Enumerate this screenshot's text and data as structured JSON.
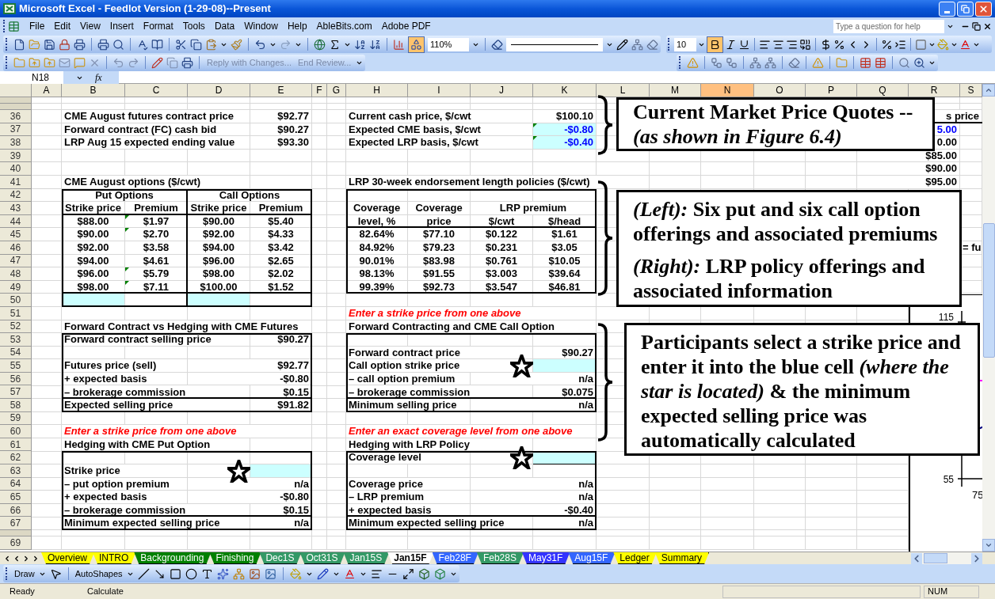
{
  "window": {
    "title": "Microsoft Excel - Feedlot Version (1-29-08)--Present"
  },
  "menu": [
    "File",
    "Edit",
    "View",
    "Insert",
    "Format",
    "Tools",
    "Data",
    "Window",
    "Help",
    "AbleBits.com",
    "Adobe PDF"
  ],
  "help_field": {
    "placeholder": "Type a question for help"
  },
  "standard_toolbar": {
    "zoom": "110%",
    "drawing_pressed": true
  },
  "formatting_toolbar": {
    "font_size": "10",
    "bold_pressed": true
  },
  "reviewing_toolbar": {
    "reply": "Reply with Changes...",
    "end_review": "End Review..."
  },
  "formula_bar": {
    "name_box": "N18",
    "fx_label": "fx"
  },
  "sheet": {
    "columns": [
      {
        "label": "A",
        "selected": false
      },
      {
        "label": "B",
        "selected": false
      },
      {
        "label": "C",
        "selected": false
      },
      {
        "label": "D",
        "selected": false
      },
      {
        "label": "E",
        "selected": false
      },
      {
        "label": "F",
        "selected": false
      },
      {
        "label": "G",
        "selected": false
      },
      {
        "label": "H",
        "selected": false
      },
      {
        "label": "I",
        "selected": false
      },
      {
        "label": "J",
        "selected": false
      },
      {
        "label": "K",
        "selected": false
      },
      {
        "label": "L",
        "selected": false
      },
      {
        "label": "M",
        "selected": false
      },
      {
        "label": "N",
        "selected": true
      },
      {
        "label": "O",
        "selected": false
      },
      {
        "label": "P",
        "selected": false
      },
      {
        "label": "Q",
        "selected": false
      },
      {
        "label": "R",
        "selected": false
      },
      {
        "label": "S",
        "selected": false
      }
    ],
    "rows": [
      {
        "collapsed": true,
        "cells": []
      },
      {
        "collapsed": true,
        "cells": []
      },
      {
        "collapsed": false,
        "number": "36",
        "cells": [
          "",
          {
            "text": "CME August futures contract price",
            "kind": "label"
          },
          "",
          "",
          {
            "text": "$92.77",
            "kind": "value"
          },
          "",
          "",
          {
            "text": "Current cash price, $/cwt",
            "kind": "label"
          },
          "",
          "",
          {
            "text": "$100.10",
            "kind": "value"
          },
          "",
          "",
          "",
          "",
          "",
          "",
          "",
          {
            "text": "s price",
            "kind": "value"
          }
        ]
      },
      {
        "collapsed": false,
        "number": "37",
        "cells": [
          "",
          {
            "text": "Forward contract (FC) cash bid",
            "kind": "label"
          },
          "",
          "",
          {
            "text": "$90.27",
            "kind": "value"
          },
          "",
          "",
          {
            "text": "Expected CME basis, $/cwt",
            "kind": "label"
          },
          "",
          "",
          {
            "text": "-$0.80",
            "kind": "input",
            "flagged": true,
            "starred": false
          },
          "",
          "",
          "",
          "",
          "",
          "",
          {
            "text": "5.00",
            "kind": "blue"
          }
        ]
      },
      {
        "collapsed": false,
        "number": "38",
        "cells": [
          "",
          {
            "text": "LRP Aug 15 expected ending value",
            "kind": "label"
          },
          "",
          "",
          {
            "text": "$93.30",
            "kind": "value"
          },
          "",
          "",
          {
            "text": "Expected LRP basis, $/cwt",
            "kind": "label"
          },
          "",
          "",
          {
            "text": "-$0.40",
            "kind": "input",
            "flagged": true,
            "starred": false
          },
          "",
          "",
          "",
          "",
          "",
          "",
          {
            "text": "0.00",
            "kind": "value"
          }
        ]
      },
      {
        "collapsed": false,
        "number": "39",
        "cells": [
          "",
          "",
          "",
          "",
          "",
          "",
          "",
          "",
          "",
          "",
          "",
          "",
          "",
          "",
          "",
          "",
          "",
          {
            "text": "$85.00",
            "kind": "value"
          }
        ]
      },
      {
        "collapsed": false,
        "number": "40",
        "cells": [
          "",
          "",
          "",
          "",
          "",
          "",
          "",
          "",
          "",
          "",
          "",
          "",
          "",
          "",
          "",
          "",
          "",
          {
            "text": "$90.00",
            "kind": "value"
          }
        ]
      },
      {
        "collapsed": false,
        "number": "41",
        "cells": [
          "",
          {
            "text": "CME August options ($/cwt)",
            "kind": "label"
          },
          "",
          "",
          "",
          "",
          "",
          {
            "text": "LRP 30-week endorsement length policies ($/cwt)",
            "kind": "label"
          },
          "",
          "",
          "",
          "",
          "",
          "",
          "",
          "",
          "",
          {
            "text": "$95.00",
            "kind": "value"
          }
        ]
      },
      {
        "collapsed": false,
        "number": "42",
        "cells": [
          "",
          {
            "text": "Put Options",
            "kind": "center"
          },
          "",
          {
            "text": "Call Options",
            "kind": "center"
          },
          ""
        ]
      },
      {
        "collapsed": false,
        "number": "43",
        "cells": [
          "",
          {
            "text": "Strike price",
            "kind": "center"
          },
          {
            "text": "Premium",
            "kind": "center"
          },
          {
            "text": "Strike price",
            "kind": "center"
          },
          {
            "text": "Premium",
            "kind": "center"
          },
          "",
          "",
          {
            "text": "Coverage",
            "kind": "center"
          },
          {
            "text": "Coverage",
            "kind": "center"
          },
          {
            "text": "LRP premium",
            "kind": "center"
          },
          ""
        ]
      },
      {
        "collapsed": false,
        "number": "44",
        "cells": [
          "",
          {
            "text": "$88.00",
            "kind": "center"
          },
          {
            "text": "$1.97",
            "kind": "center",
            "flagged": true
          },
          {
            "text": "$90.00",
            "kind": "center"
          },
          {
            "text": "$5.40",
            "kind": "center"
          },
          "",
          "",
          {
            "text": "level, %",
            "kind": "center"
          },
          {
            "text": "price",
            "kind": "center"
          },
          {
            "text": "$/cwt",
            "kind": "center"
          },
          {
            "text": "$/head",
            "kind": "center"
          }
        ]
      },
      {
        "collapsed": false,
        "number": "45",
        "cells": [
          "",
          {
            "text": "$90.00",
            "kind": "center"
          },
          {
            "text": "$2.70",
            "kind": "center",
            "flagged": true
          },
          {
            "text": "$92.00",
            "kind": "center"
          },
          {
            "text": "$4.33",
            "kind": "center"
          },
          "",
          "",
          {
            "text": "82.64%",
            "kind": "center"
          },
          {
            "text": "$77.10",
            "kind": "center"
          },
          {
            "text": "$0.122",
            "kind": "center"
          },
          {
            "text": "$1.61",
            "kind": "center"
          }
        ]
      },
      {
        "collapsed": false,
        "number": "46",
        "cells": [
          "",
          {
            "text": "$92.00",
            "kind": "center"
          },
          {
            "text": "$3.58",
            "kind": "center"
          },
          {
            "text": "$94.00",
            "kind": "center"
          },
          {
            "text": "$3.42",
            "kind": "center"
          },
          "",
          "",
          {
            "text": "84.92%",
            "kind": "center"
          },
          {
            "text": "$79.23",
            "kind": "center"
          },
          {
            "text": "$0.231",
            "kind": "center"
          },
          {
            "text": "$3.05",
            "kind": "center"
          },
          "",
          "",
          "",
          "",
          "",
          "",
          "",
          {
            "text": "= fu",
            "kind": "label"
          }
        ]
      },
      {
        "collapsed": false,
        "number": "47",
        "cells": [
          "",
          {
            "text": "$94.00",
            "kind": "center"
          },
          {
            "text": "$4.61",
            "kind": "center"
          },
          {
            "text": "$96.00",
            "kind": "center"
          },
          {
            "text": "$2.65",
            "kind": "center"
          },
          "",
          "",
          {
            "text": "90.01%",
            "kind": "center"
          },
          {
            "text": "$83.98",
            "kind": "center"
          },
          {
            "text": "$0.761",
            "kind": "center"
          },
          {
            "text": "$10.05",
            "kind": "center"
          }
        ]
      },
      {
        "collapsed": false,
        "number": "48",
        "cells": [
          "",
          {
            "text": "$96.00",
            "kind": "center"
          },
          {
            "text": "$5.79",
            "kind": "center",
            "flagged": true
          },
          {
            "text": "$98.00",
            "kind": "center"
          },
          {
            "text": "$2.02",
            "kind": "center"
          },
          "",
          "",
          {
            "text": "98.13%",
            "kind": "center"
          },
          {
            "text": "$91.55",
            "kind": "center"
          },
          {
            "text": "$3.003",
            "kind": "center"
          },
          {
            "text": "$39.64",
            "kind": "center"
          }
        ]
      },
      {
        "collapsed": false,
        "number": "49",
        "cells": [
          "",
          {
            "text": "$98.00",
            "kind": "center"
          },
          {
            "text": "$7.11",
            "kind": "center",
            "flagged": true
          },
          {
            "text": "$100.00",
            "kind": "center"
          },
          {
            "text": "$1.52",
            "kind": "center"
          },
          "",
          "",
          {
            "text": "99.39%",
            "kind": "center"
          },
          {
            "text": "$92.73",
            "kind": "center"
          },
          {
            "text": "$3.547",
            "kind": "center"
          },
          {
            "text": "$46.81",
            "kind": "center"
          }
        ]
      },
      {
        "collapsed": false,
        "number": "50",
        "cells": [
          "",
          {
            "kind": "input",
            "starred": false
          },
          "",
          {
            "kind": "input",
            "starred": false
          }
        ]
      },
      {
        "collapsed": false,
        "number": "51",
        "cells": [
          "",
          "",
          "",
          "",
          "",
          "",
          "",
          {
            "text": "Enter a strike price from one above",
            "kind": "note"
          },
          "",
          "",
          ""
        ]
      },
      {
        "collapsed": false,
        "number": "52",
        "cells": [
          "",
          {
            "text": "Forward Contract vs Hedging with CME Futures",
            "kind": "label"
          },
          "",
          "",
          "",
          "",
          "",
          {
            "text": "Forward Contracting and CME Call Option",
            "kind": "label"
          },
          "",
          "",
          ""
        ]
      },
      {
        "collapsed": false,
        "number": "53",
        "cells": [
          "",
          {
            "text": "Forward contract selling price",
            "kind": "label"
          },
          "",
          "",
          {
            "text": "$90.27",
            "kind": "value"
          }
        ]
      },
      {
        "collapsed": false,
        "number": "54",
        "cells": [
          "",
          "",
          "",
          "",
          "",
          "",
          "",
          {
            "text": "Forward contract price",
            "kind": "label"
          },
          "",
          "",
          {
            "text": "$90.27",
            "kind": "value"
          }
        ]
      },
      {
        "collapsed": false,
        "number": "55",
        "cells": [
          "",
          {
            "text": "Futures price (sell)",
            "kind": "label"
          },
          "",
          "",
          {
            "text": "$92.77",
            "kind": "value"
          },
          "",
          "",
          {
            "text": "Call option strike price",
            "kind": "label"
          },
          "",
          "",
          {
            "kind": "input",
            "starred": true
          }
        ]
      },
      {
        "collapsed": false,
        "number": "56",
        "cells": [
          "",
          {
            "text": "+ expected basis",
            "kind": "label"
          },
          "",
          "",
          {
            "text": "-$0.80",
            "kind": "value"
          },
          "",
          "",
          {
            "text": "– call option premium",
            "kind": "label"
          },
          "",
          "",
          {
            "text": "n/a",
            "kind": "value"
          }
        ]
      },
      {
        "collapsed": false,
        "number": "57",
        "cells": [
          "",
          {
            "text": "– brokerage commission",
            "kind": "label"
          },
          "",
          "",
          {
            "text": "$0.15",
            "kind": "value"
          },
          "",
          "",
          {
            "text": "– brokerage commission",
            "kind": "label"
          },
          "",
          "",
          {
            "text": "$0.075",
            "kind": "value"
          }
        ]
      },
      {
        "collapsed": false,
        "number": "58",
        "cells": [
          "",
          {
            "text": "Expected selling price",
            "kind": "label"
          },
          "",
          "",
          {
            "text": "$91.82",
            "kind": "value"
          },
          "",
          "",
          {
            "text": "Minimum selling price",
            "kind": "label"
          },
          "",
          "",
          {
            "text": "n/a",
            "kind": "value"
          }
        ]
      },
      {
        "collapsed": false,
        "number": "59",
        "cells": []
      },
      {
        "collapsed": false,
        "number": "60",
        "cells": [
          "",
          {
            "text": "Enter a strike price from one above",
            "kind": "note"
          },
          "",
          "",
          "",
          "",
          "",
          {
            "text": "Enter an exact coverage level from one above",
            "kind": "note"
          },
          "",
          "",
          ""
        ]
      },
      {
        "collapsed": false,
        "number": "61",
        "cells": [
          "",
          {
            "text": "Hedging with CME Put Option",
            "kind": "label"
          },
          "",
          "",
          "",
          "",
          "",
          {
            "text": "Hedging with LRP Policy",
            "kind": "label"
          },
          "",
          ""
        ]
      },
      {
        "collapsed": false,
        "number": "62",
        "cells": [
          "",
          "",
          "",
          "",
          "",
          "",
          "",
          {
            "text": "Coverage level",
            "kind": "label"
          },
          "",
          "",
          {
            "kind": "input",
            "starred": true
          }
        ]
      },
      {
        "collapsed": false,
        "number": "63",
        "cells": [
          "",
          {
            "text": "Strike price",
            "kind": "label"
          },
          "",
          "",
          {
            "kind": "input",
            "starred": true
          }
        ]
      },
      {
        "collapsed": false,
        "number": "64",
        "cells": [
          "",
          {
            "text": "– put option premium",
            "kind": "label"
          },
          "",
          "",
          {
            "text": "n/a",
            "kind": "value"
          },
          "",
          "",
          {
            "text": "Coverage price",
            "kind": "label"
          },
          "",
          "",
          {
            "text": "n/a",
            "kind": "value"
          }
        ]
      },
      {
        "collapsed": false,
        "number": "65",
        "cells": [
          "",
          {
            "text": "+ expected basis",
            "kind": "label"
          },
          "",
          "",
          {
            "text": "-$0.80",
            "kind": "value"
          },
          "",
          "",
          {
            "text": "– LRP premium",
            "kind": "label"
          },
          "",
          "",
          {
            "text": "n/a",
            "kind": "value"
          }
        ]
      },
      {
        "collapsed": false,
        "number": "66",
        "cells": [
          "",
          {
            "text": "– brokerage commission",
            "kind": "label"
          },
          "",
          "",
          {
            "text": "$0.15",
            "kind": "value"
          },
          "",
          "",
          {
            "text": "+ expected basis",
            "kind": "label"
          },
          "",
          "",
          {
            "text": "-$0.40",
            "kind": "value"
          }
        ]
      },
      {
        "collapsed": false,
        "number": "67",
        "cells": [
          "",
          {
            "text": "Minimum expected selling price",
            "kind": "label"
          },
          "",
          "",
          {
            "text": "n/a",
            "kind": "value"
          },
          "",
          "",
          {
            "text": "Minimum expected selling price",
            "kind": "label"
          },
          "",
          "",
          {
            "text": "n/a",
            "kind": "value"
          }
        ]
      },
      {
        "collapsed": true,
        "cells": []
      },
      {
        "collapsed": false,
        "number": "69",
        "cells": []
      }
    ],
    "chart_fragment": {
      "y_ticks": [
        "115",
        "55"
      ],
      "x_ticks": [
        "75"
      ]
    }
  },
  "callouts": [
    {
      "paragraphs": [
        [
          "Current Market Price Quotes --",
          "*(as shown in Figure 6.4)*"
        ]
      ]
    },
    {
      "paragraphs": [
        [
          "*(Left):* Six put and six call option",
          "offerings and associated premiums"
        ],
        [
          "*(Right):* LRP policy offerings and",
          "associated information"
        ]
      ]
    },
    {
      "paragraphs": [
        [
          "Participants select a strike price and",
          "enter it into the blue cell *(where the*",
          "*star is located)* & the minimum",
          "expected selling price was",
          "automatically calculated"
        ]
      ]
    }
  ],
  "sheet_tabs": [
    {
      "label": "Overview",
      "color": "#ffff00",
      "selected": false
    },
    {
      "label": "INTRO",
      "color": "#ffff00",
      "selected": false
    },
    {
      "label": "Backgrounding",
      "color": "#008000",
      "selected": false
    },
    {
      "label": "Finishing",
      "color": "#008000",
      "selected": false
    },
    {
      "label": "Dec1S",
      "color": "#339966",
      "selected": false
    },
    {
      "label": "Oct31S",
      "color": "#339966",
      "selected": false
    },
    {
      "label": "Jan15S",
      "color": "#339966",
      "selected": false
    },
    {
      "label": "Jan15F",
      "selected": true
    },
    {
      "label": "Feb28F",
      "color": "#3366ff",
      "selected": false
    },
    {
      "label": "Feb28S",
      "color": "#339966",
      "selected": false
    },
    {
      "label": "May31F",
      "color": "#3333ff",
      "selected": false
    },
    {
      "label": "Aug15F",
      "color": "#3366ff",
      "selected": false
    },
    {
      "label": "Ledger",
      "color": "#ffff00",
      "selected": false
    },
    {
      "label": "Summary",
      "color": "#ffff00",
      "selected": false
    }
  ],
  "drawing_toolbar": {
    "draw": "Draw",
    "autoshapes": "AutoShapes"
  },
  "status_bar": {
    "left": "Ready",
    "middle": "Calculate",
    "num": "NUM"
  }
}
